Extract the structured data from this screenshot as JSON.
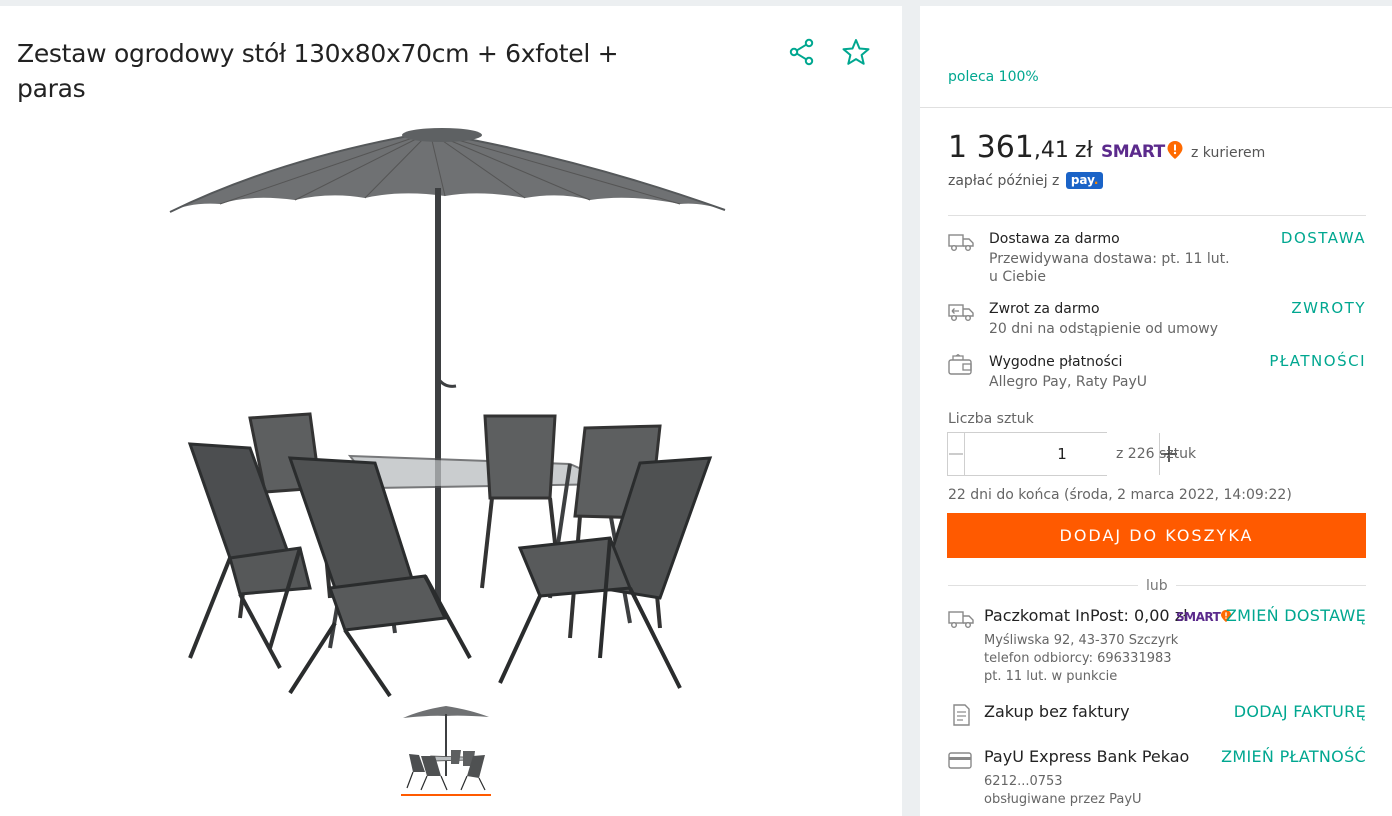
{
  "product": {
    "title": "Zestaw ogrodowy stół 130x80x70cm + 6xfotel + paras",
    "share_icon": "share-icon",
    "favorite_icon": "star-icon"
  },
  "seller": {
    "rating": "poleca 100%"
  },
  "price": {
    "integer": "1 361",
    "decimal": ",41",
    "currency": "zł",
    "smart_label": "SMART",
    "courier_text": "z kurierem",
    "pay_later_text": "zapłać później z",
    "pay_logo": "pay",
    "smart_color": "#5b2a8c",
    "accent_color": "#00a790",
    "cta_color": "#ff5a00"
  },
  "info": [
    {
      "title": "Dostawa za darmo",
      "sub1": "Przewidywana dostawa: pt. 11 lut.",
      "sub2": "u Ciebie",
      "link": "DOSTAWA",
      "icon": "truck-icon"
    },
    {
      "title": "Zwrot za darmo",
      "sub1": "20 dni na odstąpienie od umowy",
      "link": "ZWROTY",
      "icon": "return-truck-icon"
    },
    {
      "title": "Wygodne płatności",
      "sub1": "Allegro Pay, Raty PayU",
      "link": "PŁATNOŚCI",
      "icon": "wallet-icon"
    }
  ],
  "quantity": {
    "label": "Liczba sztuk",
    "value": "1",
    "available": "z 226 sztuk"
  },
  "ends_text": "22 dni do końca (środa, 2 marca 2022, 14:09:22)",
  "add_to_cart": "DODAJ DO KOSZYKA",
  "or_text": "lub",
  "options": [
    {
      "title": "Paczkomat InPost: 0,00 zł",
      "smart": "SMART",
      "link": "ZMIEŃ DOSTAWĘ",
      "sub": [
        "Myśliwska 92, 43-370 Szczyrk",
        "telefon odbiorcy: 696331983",
        "pt. 11 lut. w punkcie"
      ],
      "icon": "parcel-locker-icon"
    },
    {
      "title": "Zakup bez faktury",
      "link": "DODAJ FAKTURĘ",
      "sub": [],
      "icon": "invoice-icon"
    },
    {
      "title": "PayU Express Bank Pekao",
      "link": "ZMIEŃ PŁATNOŚĆ",
      "sub": [
        "6212...0753",
        "obsługiwane przez PayU"
      ],
      "icon": "card-icon"
    }
  ]
}
